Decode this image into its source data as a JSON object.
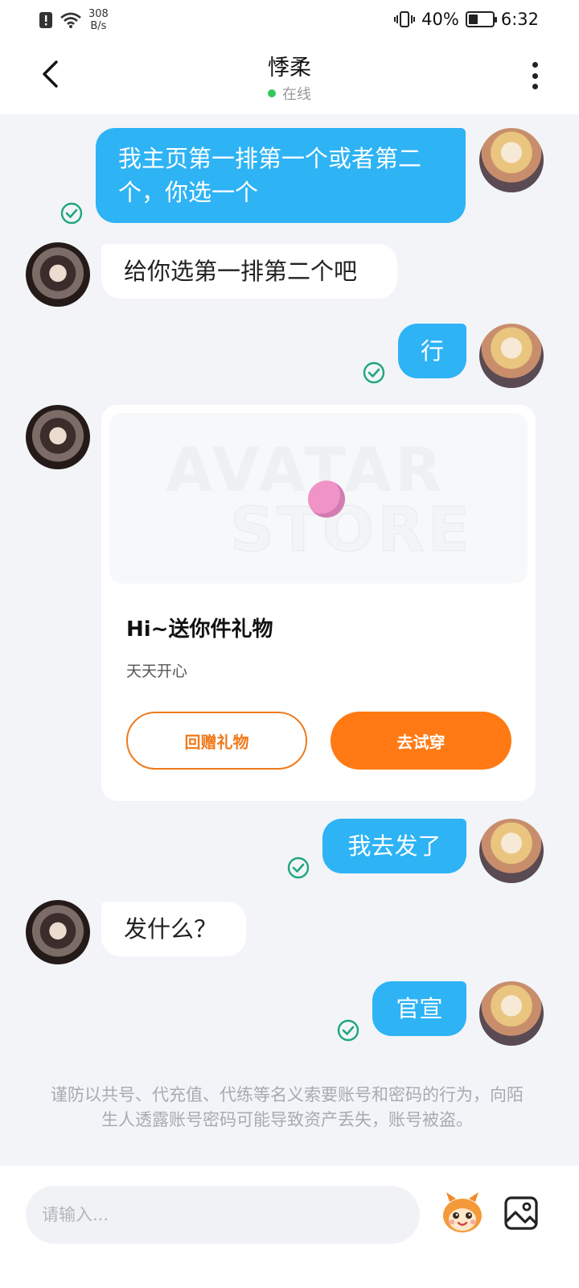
{
  "status_bar": {
    "net_speed": "308",
    "net_unit": "B/s",
    "battery_percent": "40%",
    "battery_level": 0.4,
    "time": "6:32"
  },
  "header": {
    "title": "悸柔",
    "status": "在线",
    "status_color": "#34c759"
  },
  "messages": [
    {
      "side": "out",
      "text": "我主页第一排第一个或者第二个，你选一个",
      "read": true
    },
    {
      "side": "in",
      "text": "给你选第一排第二个吧"
    },
    {
      "side": "out",
      "text": "行",
      "read": true
    },
    {
      "side": "in",
      "type": "gift-card"
    },
    {
      "side": "out",
      "text": "我去发了",
      "read": true
    },
    {
      "side": "in",
      "text": "发什么？"
    },
    {
      "side": "out",
      "text": "官宣",
      "read": true
    }
  ],
  "gift_card": {
    "watermark_line1": "AVATAR",
    "watermark_line2": "STORE",
    "title": "Hi~送你件礼物",
    "subtitle": "天天开心",
    "return_gift_label": "回赠礼物",
    "try_on_label": "去试穿"
  },
  "notice": "谨防以共号、代充值、代练等名义索要账号和密码的行为，向陌生人透露账号密码可能导致资产丢失，账号被盗。",
  "composer": {
    "placeholder": "请输入..."
  },
  "colors": {
    "outgoing_bubble": "#2eb3f5",
    "incoming_bubble": "#ffffff",
    "accent_orange": "#ff7a14",
    "read_check": "#1fa77a",
    "background": "#f2f4f8"
  },
  "icons": [
    "back-arrow-icon",
    "more-vertical-icon",
    "read-check-icon",
    "emoji-mascot-icon",
    "image-icon",
    "wifi-icon",
    "alert-icon",
    "vibrate-icon",
    "battery-icon"
  ]
}
